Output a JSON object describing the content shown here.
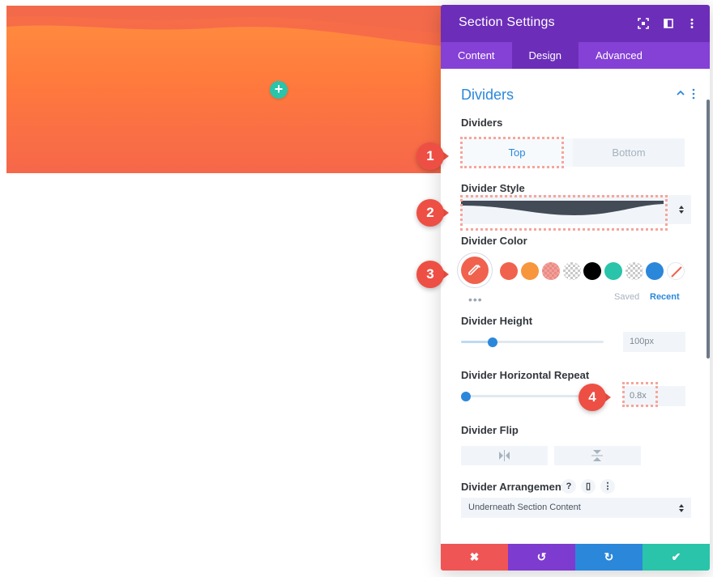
{
  "preview": {
    "add_icon": "plus-icon",
    "add_symbol": "+",
    "colors": {
      "top": "#ff8f3f",
      "bottom": "#f6674a",
      "add_button": "#29c4a9"
    }
  },
  "panel": {
    "title": "Section Settings",
    "header_icons": [
      "focus-icon",
      "split-view-icon",
      "more-vertical-icon"
    ],
    "tabs": [
      {
        "label": "Content",
        "active": false
      },
      {
        "label": "Design",
        "active": true
      },
      {
        "label": "Advanced",
        "active": false
      }
    ],
    "group_title": "Dividers",
    "dividers_label": "Dividers",
    "dividers_toggle": {
      "top_label": "Top",
      "bottom_label": "Bottom",
      "selected": "Top"
    },
    "divider_style_label": "Divider Style",
    "divider_color_label": "Divider Color",
    "swatches": [
      "#f0624d",
      "#f7963d",
      "checker-pink",
      "checker",
      "#000000",
      "#29c4a9",
      "checker",
      "#2b87da",
      "none"
    ],
    "more_symbol": "•••",
    "saved_label": "Saved",
    "recent_label": "Recent",
    "divider_height_label": "Divider Height",
    "divider_height_value": "100px",
    "divider_height_fraction": 0.2,
    "divider_repeat_label": "Divider Horizontal Repeat",
    "divider_repeat_value": "0.8x",
    "divider_repeat_fraction": 0.0,
    "divider_flip_label": "Divider Flip",
    "flip_icons": [
      "flip-horizontal-icon",
      "flip-vertical-icon"
    ],
    "divider_arrangement_label": "Divider Arrangement",
    "arrangement_icons": {
      "help": "?",
      "device": "▯",
      "more": "⋮"
    },
    "divider_arrangement_value": "Underneath Section Content",
    "footer": {
      "buttons": [
        {
          "name": "cancel",
          "icon": "close-icon",
          "symbol": "✖",
          "color": "#ef5555"
        },
        {
          "name": "undo",
          "icon": "undo-icon",
          "symbol": "↺",
          "color": "#7e3bd0"
        },
        {
          "name": "redo",
          "icon": "redo-icon",
          "symbol": "↻",
          "color": "#2b87da"
        },
        {
          "name": "save",
          "icon": "check-icon",
          "symbol": "✔",
          "color": "#29c4a9"
        }
      ]
    },
    "colors": {
      "header": "#6c2eb9",
      "tabs": "#8540d6",
      "accent": "#2b87da"
    }
  },
  "callouts": [
    "1",
    "2",
    "3",
    "4"
  ]
}
